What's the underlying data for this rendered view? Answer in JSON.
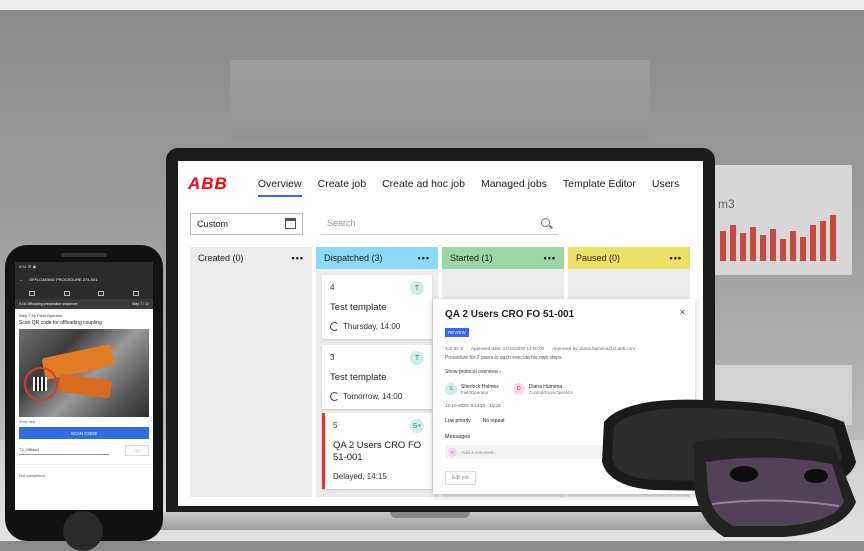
{
  "brand": {
    "logo": "ABB",
    "logo_color": "#ff000f",
    "accent": "#3366ff"
  },
  "background": {
    "monitor_text": "m3"
  },
  "nav": {
    "items": [
      {
        "label": "Overview",
        "active": true
      },
      {
        "label": "Create job"
      },
      {
        "label": "Create ad hoc job"
      },
      {
        "label": "Managed jobs"
      },
      {
        "label": "Template Editor"
      },
      {
        "label": "Users"
      }
    ]
  },
  "filter": {
    "value": "Custom"
  },
  "search": {
    "placeholder": "Search"
  },
  "columns": [
    {
      "title": "Created (0)",
      "menu": "•••",
      "color": "#ececec"
    },
    {
      "title": "Dispatched (3)",
      "menu": "•••",
      "color": "#8dd8f8"
    },
    {
      "title": "Started (1)",
      "menu": "•••",
      "color": "#9ad7a4"
    },
    {
      "title": "Paused (0)",
      "menu": "•••",
      "color": "#ece164"
    }
  ],
  "cards": [
    {
      "number": "4",
      "title": "Test template",
      "time": "Thursday, 14:00",
      "avatar": "T"
    },
    {
      "number": "3",
      "title": "Test template",
      "time": "Tomorrow, 14:00",
      "avatar": "T"
    },
    {
      "number": "5",
      "title": "QA 2 Users CRO FO 51-001",
      "time": "Delayed, 14:15",
      "avatar": "S+"
    }
  ],
  "detail": {
    "title": "QA 2 Users CRO FO 51-001",
    "close": "×",
    "badge": "REVIEW",
    "meta": [
      "Job ID: 5",
      "Approved date: 12/10/2020 14:00:00",
      "Approved by: diana.humena@ct.abb.com"
    ],
    "description": "Procedure for 2 users to each execute his own steps.",
    "protocol_link": "Show protocol overview ›",
    "people": [
      {
        "initial": "S",
        "name": "Sherlock Holmes",
        "role": "FieldOperator"
      },
      {
        "initial": "D",
        "name": "Diana Humena",
        "role": "ControlRoomOperator"
      }
    ],
    "schedule": "12-10-2020, 8:14:15 - 15:15",
    "priority": "Low priority",
    "repeat": "No repeat",
    "messages_label": "Messages",
    "comment_initial": "P",
    "comment_placeholder": "Add a comment...",
    "edit_button": "Edit job"
  },
  "phone": {
    "status": "4:51 ⚙ ◉",
    "title": "OFFLOADING PROCEDURE 274-001",
    "step_bar": "0.16 Offloading preparation sequence",
    "step_count": "Step 7 / 12",
    "operator": "Step 7 by Field Operator",
    "instruction": "Scan QR code for offloading coupling",
    "show_help": "Show help",
    "scan_button": "SCAN CODE",
    "field_value": "T2_Offload",
    "ok_button": "OK",
    "status_text": "Not completed"
  }
}
